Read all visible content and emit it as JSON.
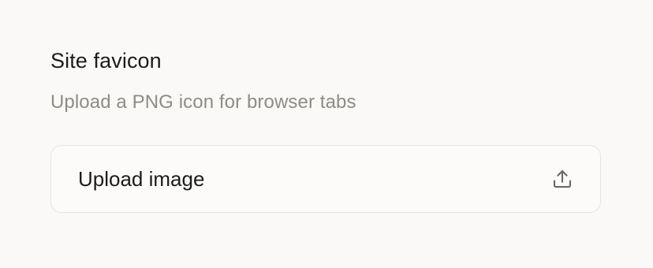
{
  "favicon_section": {
    "title": "Site favicon",
    "description": "Upload a PNG icon for browser tabs",
    "upload_button": {
      "label": "Upload image",
      "icon": "upload-icon"
    }
  },
  "colors": {
    "background": "#faf9f7",
    "text_primary": "#1c1c1c",
    "text_secondary": "#8e8c87",
    "border": "#e6e4df"
  }
}
